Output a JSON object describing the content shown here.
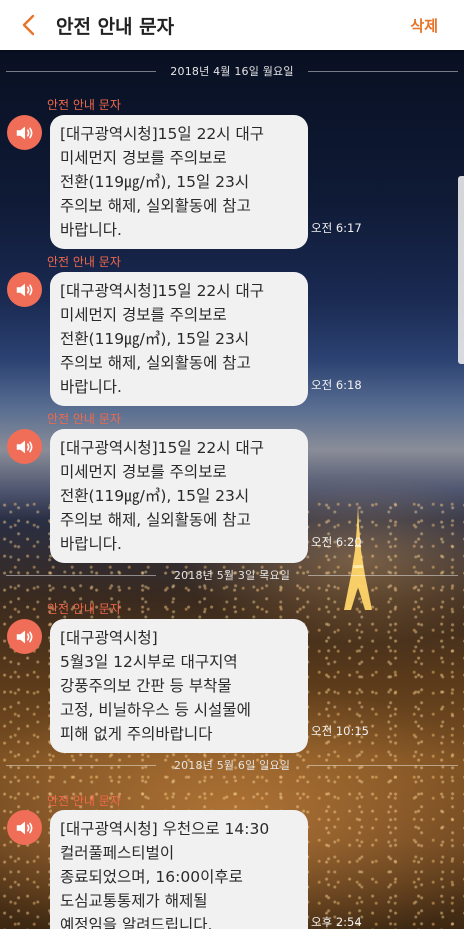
{
  "header": {
    "title": "안전 안내 문자",
    "delete_label": "삭제"
  },
  "dates": [
    "2018년 4월 16일 월요일",
    "2018년 5월 3일 목요일",
    "2018년 5월 6일 일요일"
  ],
  "messages": [
    {
      "sender": "안전 안내 문자",
      "text": "[대구광역시청]15일 22시 대구\n미세먼지 경보를 주의보로\n전환(119㎍/㎥), 15일 23시\n주의보 해제, 실외활동에 참고\n바랍니다.",
      "time": "오전 6:17"
    },
    {
      "sender": "안전 안내 문자",
      "text": "[대구광역시청]15일 22시 대구\n미세먼지 경보를 주의보로\n전환(119㎍/㎥), 15일 23시\n주의보 해제, 실외활동에 참고\n바랍니다.",
      "time": "오전 6:18"
    },
    {
      "sender": "안전 안내 문자",
      "text": "[대구광역시청]15일 22시 대구\n미세먼지 경보를 주의보로\n전환(119㎍/㎥), 15일 23시\n주의보 해제, 실외활동에 참고\n바랍니다.",
      "time": "오전 6:20"
    },
    {
      "sender": "안전 안내 문자",
      "text": "[대구광역시청]\n5월3일 12시부로 대구지역\n강풍주의보 간판 등 부착물\n고정, 비닐하우스 등 시설물에\n피해 없게 주의바랍니다",
      "time": "오전 10:15"
    },
    {
      "sender": "안전 안내 문자",
      "text": "[대구광역시청] 우천으로 14:30\n컬러풀페스티벌이\n종료되었으며, 16:00이후로\n도심교통통제가 해제될\n예정임을 알려드립니다.",
      "time": "오후 2:54"
    }
  ],
  "icons": {
    "back": "chevron-left-icon",
    "speaker": "speaker-icon"
  },
  "colors": {
    "accent": "#e8742a",
    "sender": "#f06a4c",
    "speaker_bg": "#f06d57",
    "bubble": "#f1f1f1"
  }
}
